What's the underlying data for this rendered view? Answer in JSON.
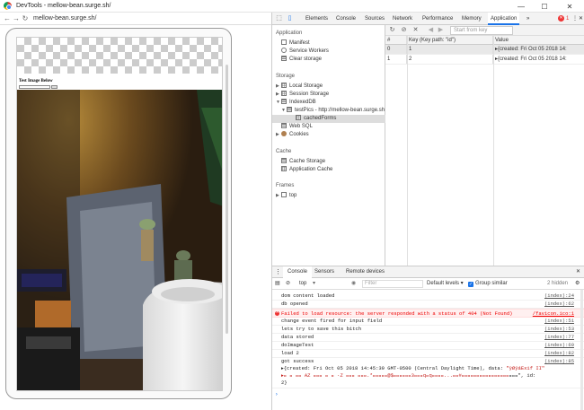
{
  "window": {
    "title": "DevTools - mellow-bean.surge.sh/",
    "minimize": "—",
    "maximize": "☐",
    "close": "✕"
  },
  "browser": {
    "url": "mellow-bean.surge.sh/"
  },
  "page": {
    "small_text": "",
    "heading": "Test Image Below"
  },
  "devtools": {
    "tabs": [
      "Elements",
      "Console",
      "Sources",
      "Network",
      "Performance",
      "Memory",
      "Application"
    ],
    "active_tab": "Application",
    "more_tabs": "»",
    "error_count": "1",
    "menu": "⋮",
    "close": "✕"
  },
  "sidebar": {
    "application_header": "Application",
    "application_items": [
      "Manifest",
      "Service Workers",
      "Clear storage"
    ],
    "storage_header": "Storage",
    "local_storage": "Local Storage",
    "session_storage": "Session Storage",
    "indexeddb": "IndexedDB",
    "db": "testPics - http://mellow-bean.surge.sh",
    "store": "cachedForms",
    "web_sql": "Web SQL",
    "cookies": "Cookies",
    "cache_header": "Cache",
    "cache_storage": "Cache Storage",
    "application_cache": "Application Cache",
    "frames_header": "Frames",
    "top": "top"
  },
  "store": {
    "search_placeholder": "Start from key",
    "columns": [
      "#",
      "Key (Key path: \"id\")",
      "Value"
    ],
    "rows": [
      {
        "index": "0",
        "key": "1",
        "value": "▸{created: Fri Oct 05 2018 14:"
      },
      {
        "index": "1",
        "key": "2",
        "value": "▸{created: Fri Oct 05 2018 14:"
      }
    ]
  },
  "drawer": {
    "tabs": [
      "Console",
      "Sensors",
      "Remote devices"
    ],
    "active_tab": "Console",
    "close": "✕",
    "context": "top",
    "filter_placeholder": "Filter",
    "levels": "Default levels ▾",
    "group_similar": "Group similar",
    "hidden": "2 hidden",
    "lines": [
      {
        "msg": "dom content loaded",
        "src": "(index):24",
        "type": "log"
      },
      {
        "msg": "db opened",
        "src": "(index):62",
        "type": "log"
      },
      {
        "msg": "Failed to load resource: the server responded with a status of 404 (Not Found)",
        "src": "/favicon.ico:1",
        "type": "error"
      },
      {
        "msg": "change event fired for input field",
        "src": "(index):51",
        "type": "log"
      },
      {
        "msg": "lets try to save this bitch",
        "src": "(index):53",
        "type": "log"
      },
      {
        "msg": "data stored",
        "src": "(index):77",
        "type": "log"
      },
      {
        "msg": "doImageTest",
        "src": "(index):69",
        "type": "log"
      },
      {
        "msg": "load 2",
        "src": "(index):82",
        "type": "log"
      },
      {
        "msg": "got success",
        "src": "(index):85",
        "type": "log"
      }
    ],
    "object_line1_a": "▸{created: Fri Oct 05 2018 14:45:39 GMT-0500 (Central Daylight Time), data: ",
    "object_line1_b": "\"ÿØÿá\u0014Exif II\"",
    "object_line2": "▸\u0000  \u0000 \u0000\u0000 AZ  \u0000\u0000\u0000 \u0000 \u0000 ·Z \u0000\u0000\u0000 \u0000\u0000\u0000.*\u0000\u0000\u0000\u0000\u0000@$\u0000\u0000\u0000\u0000\u0000\u00003\u0000\u0000\u0000q\u0000q\u0000\u0000\u0000\u0000...\u0000\u0000#\u0000\u0000\u0000\u0000\u0000\u0000\u0000\u0000\u0000\u0000\u0000\u0000\u0000\u0000\u0000\u0000",
    "object_line2_end": "\u0000\u0000\u0000\", id:",
    "object_line3": "2}"
  }
}
